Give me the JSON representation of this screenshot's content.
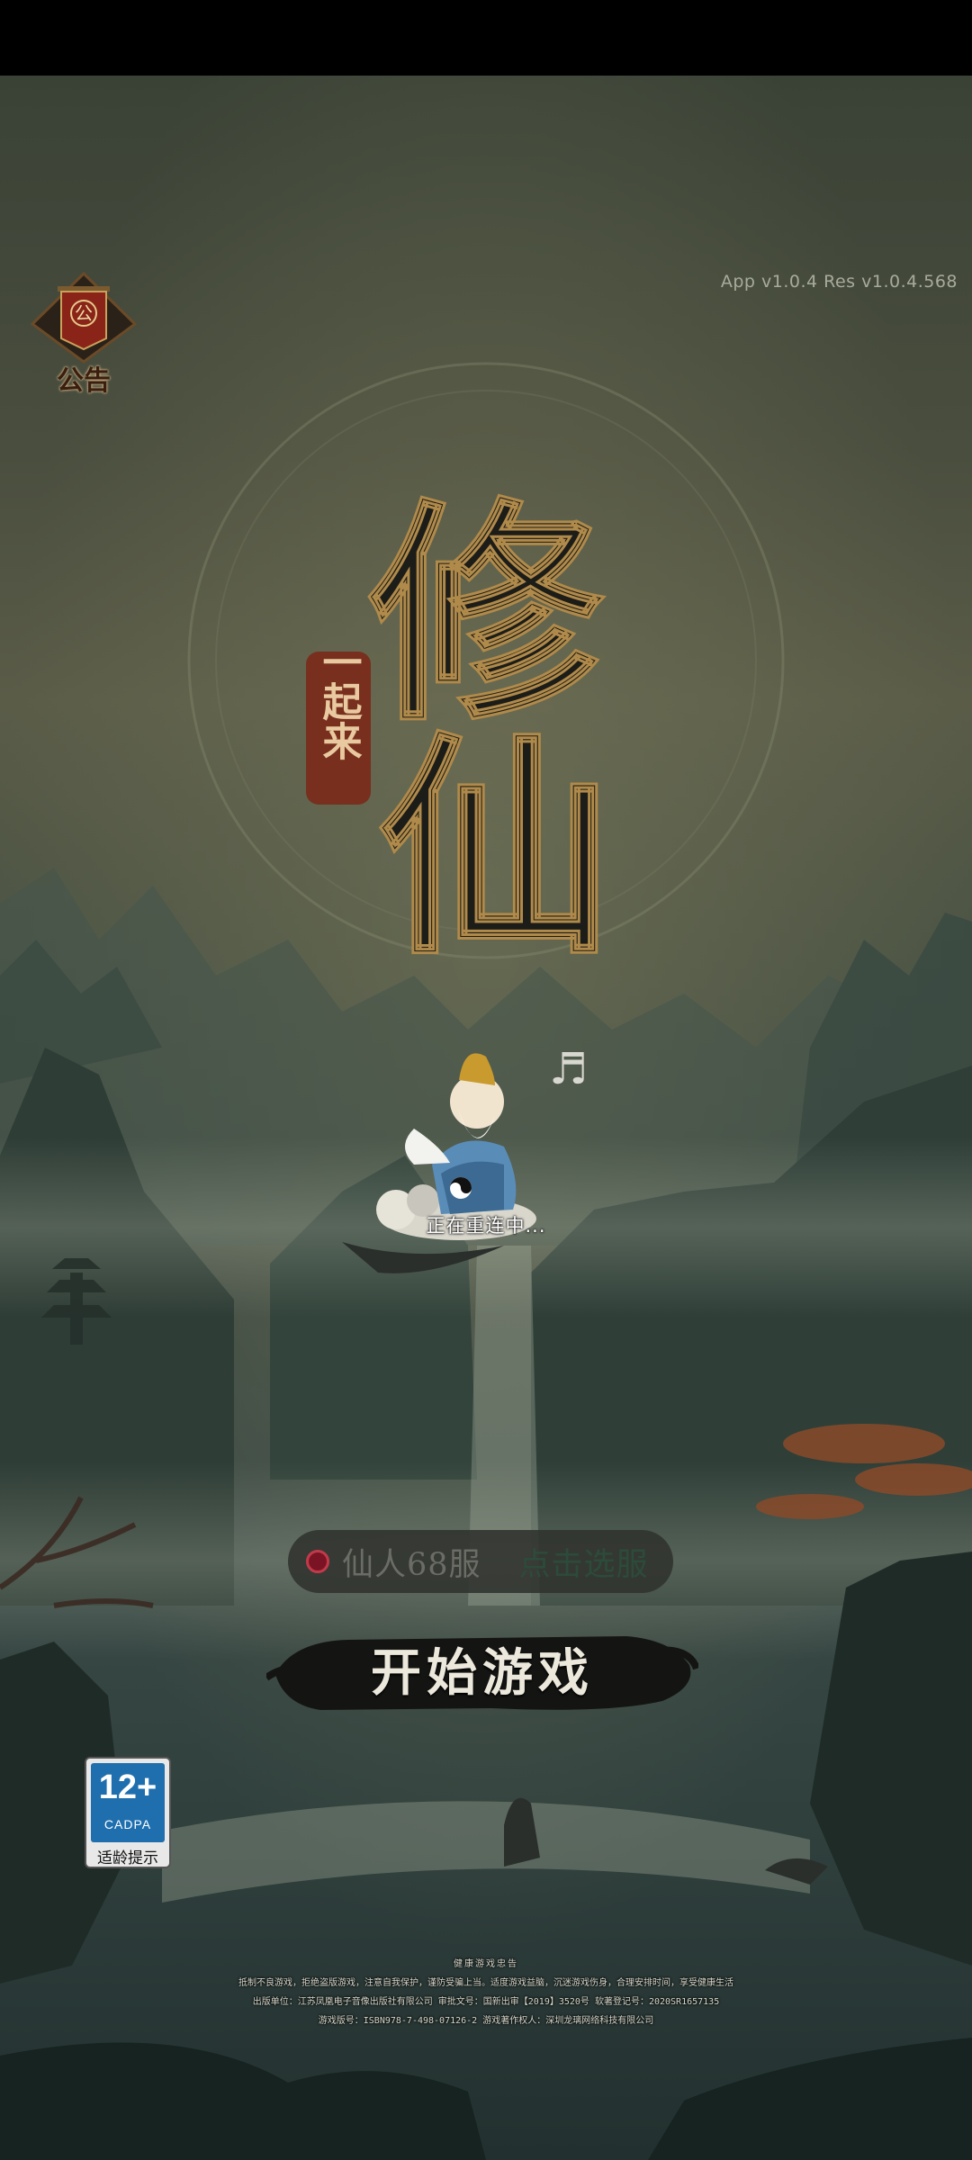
{
  "version": "App v1.0.4 Res v1.0.4.568",
  "notice": {
    "label": "公告",
    "emblem": "公"
  },
  "logo": {
    "title": "修仙",
    "subtitle": "一起来"
  },
  "status": {
    "reconnect": "正在重连中..."
  },
  "server": {
    "name": "仙人68服",
    "select_label": "点击选服",
    "status_color": "#c23a4a"
  },
  "start_button": {
    "label": "开始游戏"
  },
  "age_rating": {
    "number": "12+",
    "org": "CADPA",
    "tip": "适龄提示"
  },
  "footer": {
    "title": "健康游戏忠告",
    "line1": "抵制不良游戏，拒绝盗版游戏，注意自我保护，谨防受骗上当。适度游戏益脑，沉迷游戏伤身，合理安排时间，享受健康生活",
    "line2": "出版单位：江苏凤凰电子音像出版社有限公司  审批文号：国新出审【2019】3520号  软著登记号：2020SR1657135",
    "line3": "游戏版号：ISBN978-7-498-07126-2  游戏著作权人：深圳龙璃网络科技有限公司"
  },
  "colors": {
    "accent_red": "#8a2418",
    "ink": "#1c1c18",
    "gold": "#b08a4a"
  }
}
